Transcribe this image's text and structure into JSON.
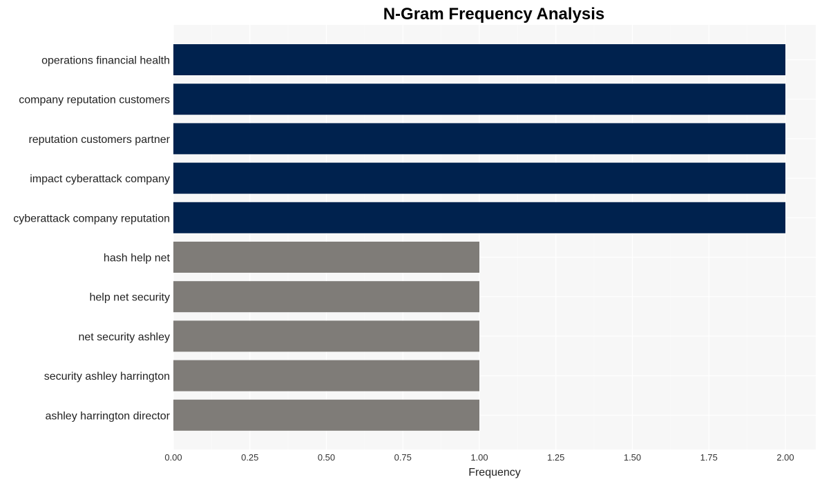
{
  "chart_data": {
    "type": "bar",
    "orientation": "horizontal",
    "title": "N-Gram Frequency Analysis",
    "xlabel": "Frequency",
    "ylabel": "",
    "xlim": [
      0,
      2.1
    ],
    "xticks": [
      0,
      0.25,
      0.5,
      0.75,
      1.0,
      1.25,
      1.5,
      1.75,
      2.0
    ],
    "xtick_labels": [
      "0.00",
      "0.25",
      "0.50",
      "0.75",
      "1.00",
      "1.25",
      "1.50",
      "1.75",
      "2.00"
    ],
    "grid": true,
    "legend": "none",
    "categories": [
      "operations financial health",
      "company reputation customers",
      "reputation customers partner",
      "impact cyberattack company",
      "cyberattack company reputation",
      "hash help net",
      "help net security",
      "net security ashley",
      "security ashley harrington",
      "ashley harrington director"
    ],
    "values": [
      2,
      2,
      2,
      2,
      2,
      1,
      1,
      1,
      1,
      1
    ],
    "colors": {
      "high": "#00224e",
      "low": "#7f7c78",
      "panel_background": "#f7f7f7",
      "grid": "#ffffff"
    }
  }
}
